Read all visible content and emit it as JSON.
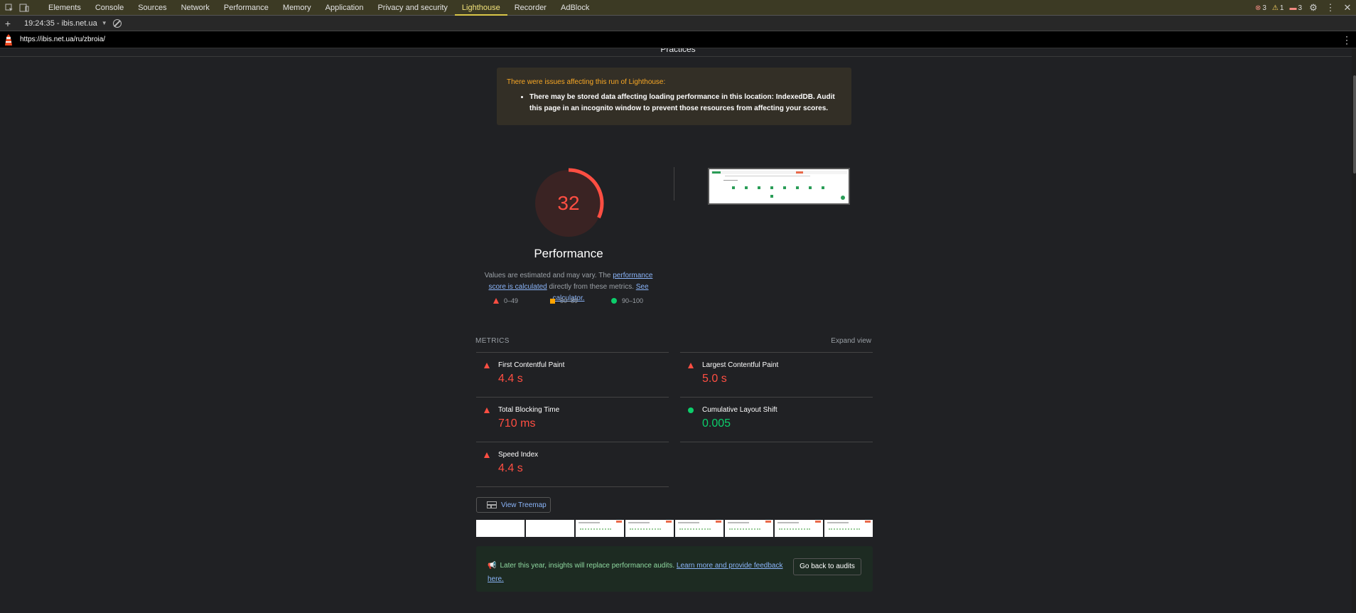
{
  "devtools": {
    "tabs": [
      "Elements",
      "Console",
      "Sources",
      "Network",
      "Performance",
      "Memory",
      "Application",
      "Privacy and security",
      "Lighthouse",
      "Recorder",
      "AdBlock"
    ],
    "active_tab": "Lighthouse",
    "counters": {
      "errors": "3",
      "warnings": "1",
      "issues": "3"
    }
  },
  "toolbar": {
    "run_label": "19:24:35 - ibis.net.ua"
  },
  "urlbar": {
    "url": "https://ibis.net.ua/ru/zbroia/"
  },
  "report": {
    "section_heading": "Practices",
    "warning": {
      "title": "There were issues affecting this run of Lighthouse:",
      "item": "There may be stored data affecting loading performance in this location: IndexedDB. Audit this page in an incognito window to prevent those resources from affecting your scores."
    },
    "gauge": {
      "score": "32",
      "score_fraction": 0.32,
      "color": "#ff4e42"
    },
    "performance": {
      "title": "Performance",
      "desc_prefix": "Values are estimated and may vary. The ",
      "desc_link": "performance score is calculated",
      "desc_middle": " directly from these metrics. ",
      "desc_link2": "See calculator."
    },
    "legend": {
      "fail": "0–49",
      "average": "50–89",
      "pass": "90–100"
    },
    "metrics": {
      "header": "METRICS",
      "expand": "Expand view",
      "fcp": {
        "name": "First Contentful Paint",
        "value": "4.4 s"
      },
      "lcp": {
        "name": "Largest Contentful Paint",
        "value": "5.0 s"
      },
      "tbt": {
        "name": "Total Blocking Time",
        "value": "710 ms"
      },
      "cls": {
        "name": "Cumulative Layout Shift",
        "value": "0.005"
      },
      "si": {
        "name": "Speed Index",
        "value": "4.4 s"
      }
    },
    "treemap_label": "View Treemap",
    "insights": {
      "text": "Later this year, insights will replace performance audits.",
      "link": "Learn more and provide feedback here.",
      "back_button": "Go back to audits"
    }
  }
}
